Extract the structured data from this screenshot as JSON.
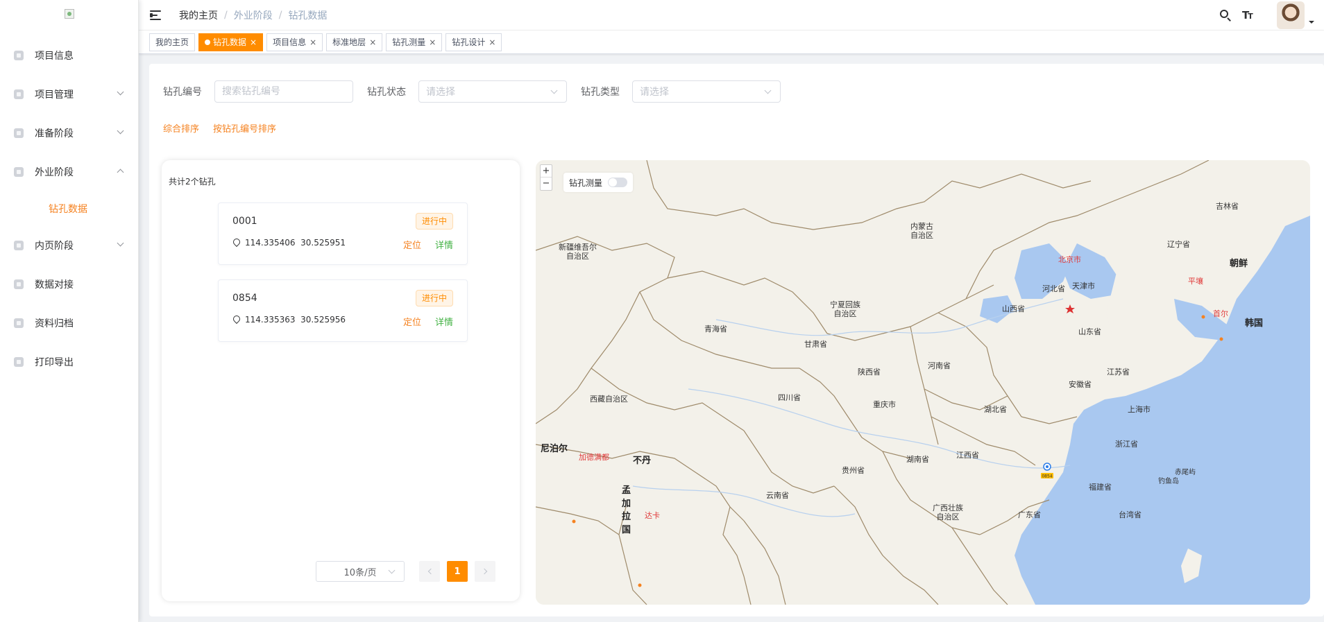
{
  "sidebar": {
    "items": [
      {
        "label": "项目信息",
        "expandable": false
      },
      {
        "label": "项目管理",
        "expandable": true,
        "expanded": false
      },
      {
        "label": "准备阶段",
        "expandable": true,
        "expanded": false
      },
      {
        "label": "外业阶段",
        "expandable": true,
        "expanded": true
      },
      {
        "label": "内页阶段",
        "expandable": true,
        "expanded": false
      },
      {
        "label": "数据对接",
        "expandable": false
      },
      {
        "label": "资料归档",
        "expandable": false
      },
      {
        "label": "打印导出",
        "expandable": false
      }
    ],
    "active_subitem": "钻孔数据"
  },
  "header": {
    "breadcrumb": [
      "我的主页",
      "外业阶段",
      "钻孔数据"
    ]
  },
  "tags": [
    {
      "label": "我的主页",
      "closable": false,
      "active": false
    },
    {
      "label": "钻孔数据",
      "closable": true,
      "active": true
    },
    {
      "label": "项目信息",
      "closable": true,
      "active": false
    },
    {
      "label": "标准地层",
      "closable": true,
      "active": false
    },
    {
      "label": "钻孔测量",
      "closable": true,
      "active": false
    },
    {
      "label": "钻孔设计",
      "closable": true,
      "active": false
    }
  ],
  "filters": {
    "borehole_no_label": "钻孔编号",
    "borehole_no_placeholder": "搜索钻孔编号",
    "status_label": "钻孔状态",
    "status_placeholder": "请选择",
    "type_label": "钻孔类型",
    "type_placeholder": "请选择"
  },
  "sorts": [
    "综合排序",
    "按钻孔编号排序"
  ],
  "list": {
    "count_text": "共计2个钻孔",
    "items": [
      {
        "id": "0001",
        "status": "进行中",
        "coords": "114.335406  30.525951",
        "locate": "定位",
        "detail": "详情"
      },
      {
        "id": "0854",
        "status": "进行中",
        "coords": "114.335363  30.525956",
        "locate": "定位",
        "detail": "详情"
      }
    ],
    "pagination": {
      "page_size": "10条/页",
      "current_page": "1"
    }
  },
  "map": {
    "zoom_in": "+",
    "zoom_out": "−",
    "layer_toggle_label": "钻孔测量",
    "marker_label": "0854",
    "colors": {
      "water": "#a9c8f0",
      "land": "#f3f1ea",
      "border": "#9e8a6a",
      "accent": "#ff8c00"
    },
    "labels": [
      {
        "text": "内蒙古自治区",
        "lines": [
          "内蒙古",
          "自治区"
        ]
      },
      {
        "text": "吉林省"
      },
      {
        "text": "辽宁省"
      },
      {
        "text": "朝鲜",
        "kind": "country"
      },
      {
        "text": "新疆维吾尔自治区",
        "lines": [
          "新疆维吾尔",
          "自治区"
        ]
      },
      {
        "text": "北京市",
        "kind": "cap"
      },
      {
        "text": "河北省"
      },
      {
        "text": "天津市"
      },
      {
        "text": "平壤",
        "kind": "city"
      },
      {
        "text": "宁夏回族自治区",
        "lines": [
          "宁夏回族",
          "自治区"
        ]
      },
      {
        "text": "山西省"
      },
      {
        "text": "首尔",
        "kind": "city"
      },
      {
        "text": "韩国",
        "kind": "country"
      },
      {
        "text": "青海省"
      },
      {
        "text": "山东省"
      },
      {
        "text": "甘肃省"
      },
      {
        "text": "河南省"
      },
      {
        "text": "陕西省"
      },
      {
        "text": "江苏省"
      },
      {
        "text": "安徽省"
      },
      {
        "text": "西藏自治区"
      },
      {
        "text": "四川省"
      },
      {
        "text": "重庆市"
      },
      {
        "text": "湖北省"
      },
      {
        "text": "上海市"
      },
      {
        "text": "尼泊尔",
        "kind": "country"
      },
      {
        "text": "加德满都",
        "kind": "city"
      },
      {
        "text": "不丹",
        "kind": "country"
      },
      {
        "text": "浙江省"
      },
      {
        "text": "江西省"
      },
      {
        "text": "湖南省"
      },
      {
        "text": "贵州省"
      },
      {
        "text": "孟加拉国",
        "kind": "country",
        "lines": [
          "孟",
          "加",
          "拉",
          "国"
        ]
      },
      {
        "text": "达卡",
        "kind": "city"
      },
      {
        "text": "赤尾屿"
      },
      {
        "text": "钓鱼岛"
      },
      {
        "text": "福建省"
      },
      {
        "text": "云南省"
      },
      {
        "text": "广西壮族自治区",
        "lines": [
          "广西壮族",
          "自治区"
        ]
      },
      {
        "text": "广东省"
      },
      {
        "text": "台湾省"
      }
    ]
  }
}
